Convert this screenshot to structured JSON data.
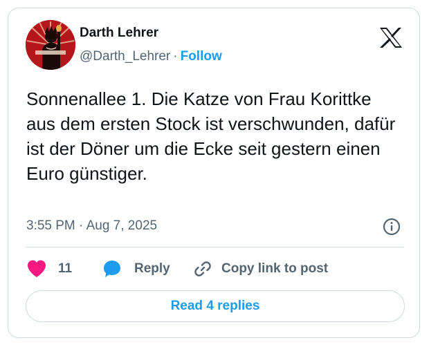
{
  "author": {
    "name": "Darth Lehrer",
    "handle": "@Darth_Lehrer",
    "separator": "·",
    "follow_label": "Follow"
  },
  "tweet": {
    "text": "Sonnenallee 1. Die Katze von Frau Korittke aus dem ersten Stock ist verschwunden, dafür ist der Döner um die Ecke seit gestern einen Euro günstiger.",
    "timestamp": "3:55 PM · Aug 7, 2025"
  },
  "actions": {
    "like_count": "11",
    "reply_label": "Reply",
    "copy_label": "Copy link to post"
  },
  "footer": {
    "read_replies_label": "Read 4 replies"
  },
  "icons": {
    "brand": "x-logo-icon",
    "info": "info-icon",
    "like": "heart-icon",
    "reply": "speech-bubble-icon",
    "copy": "link-icon"
  },
  "colors": {
    "accent": "#1d9bf0",
    "like": "#f91880",
    "secondary_text": "#536471",
    "border": "#cfd9de",
    "avatar_bg": "#b5161b"
  }
}
